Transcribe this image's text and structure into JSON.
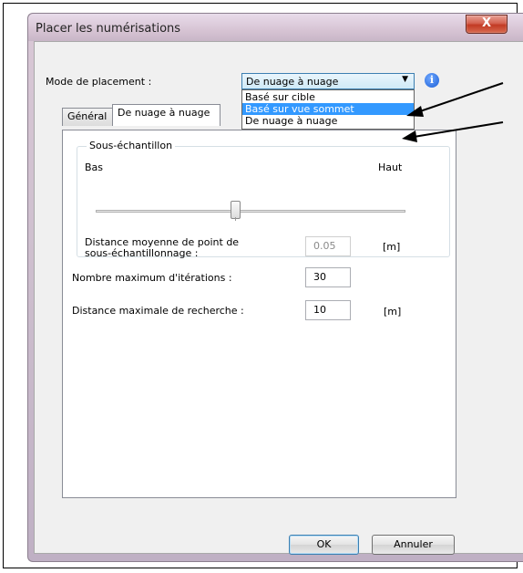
{
  "window": {
    "title": "Placer les numérisations",
    "close_label": "X"
  },
  "placement": {
    "label": "Mode de placement :",
    "selected": "De nuage à nuage",
    "dropdown_arrow": "▼",
    "info_icon_glyph": "i",
    "options": [
      "Basé sur cible",
      "Basé sur vue sommet",
      "De nuage à nuage"
    ],
    "highlighted_index": 1
  },
  "tabs": [
    {
      "label": "Général",
      "active": false
    },
    {
      "label": "De nuage à nuage",
      "active": true
    }
  ],
  "subsample": {
    "group_title": "Sous-échantillon",
    "low_label": "Bas",
    "high_label": "Haut",
    "slider_level_fraction": 0.45,
    "distance_label_line1": "Distance moyenne de point de",
    "distance_label_line2": "sous-échantillonnage :",
    "distance_value": "0.05",
    "distance_unit": "[m]"
  },
  "iterations": {
    "label": "Nombre maximum d'itérations :",
    "value": "30"
  },
  "search": {
    "label": "Distance maximale de recherche :",
    "value": "10",
    "unit": "[m]"
  },
  "buttons": {
    "ok": "OK",
    "cancel": "Annuler"
  }
}
